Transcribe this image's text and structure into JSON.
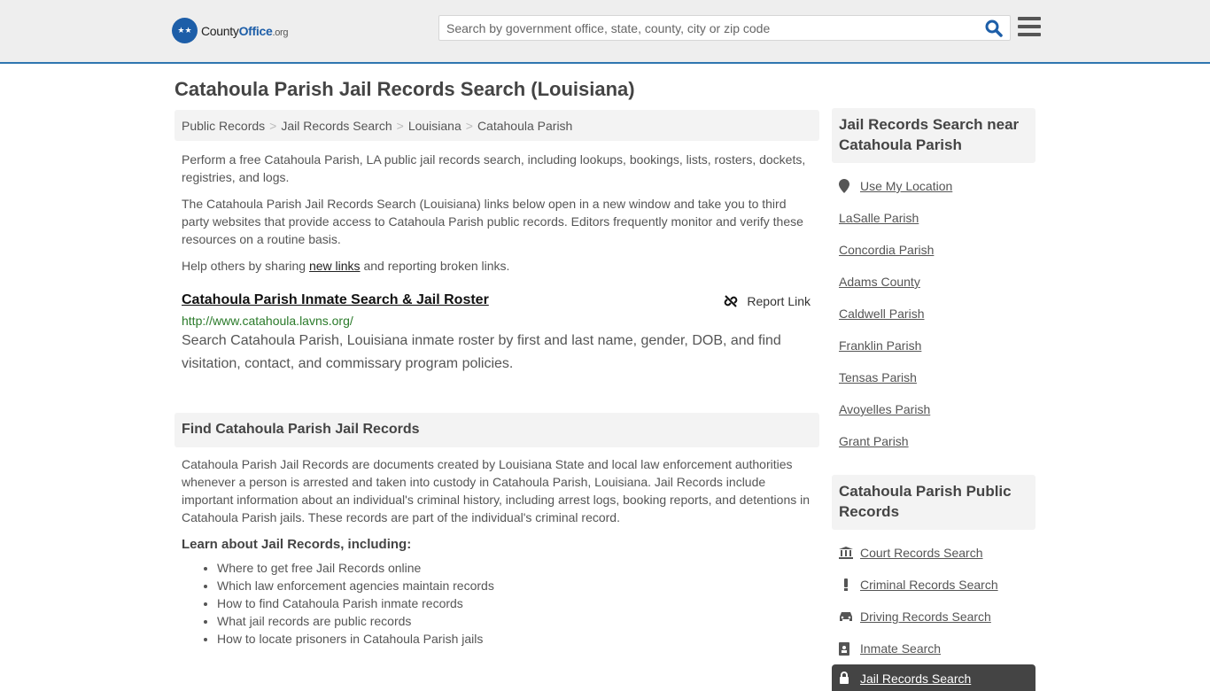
{
  "header": {
    "logo": {
      "part1": "County",
      "part2": "Office",
      "part3": ".org"
    },
    "search": {
      "placeholder": "Search by government office, state, county, city or zip code",
      "value": ""
    }
  },
  "page": {
    "title": "Catahoula Parish Jail Records Search (Louisiana)",
    "breadcrumbs": [
      "Public Records",
      "Jail Records Search",
      "Louisiana",
      "Catahoula Parish"
    ],
    "intro1": "Perform a free Catahoula Parish, LA public jail records search, including lookups, bookings, lists, rosters, dockets, registries, and logs.",
    "intro2": "The Catahoula Parish Jail Records Search (Louisiana) links below open in a new window and take you to third party websites that provide access to Catahoula Parish public records. Editors frequently monitor and verify these resources on a routine basis.",
    "help": {
      "before": "Help others by sharing ",
      "link": "new links",
      "after": " and reporting broken links."
    },
    "listing": {
      "title": "Catahoula Parish Inmate Search & Jail Roster",
      "report_label": "Report Link",
      "url": "http://www.catahoula.lavns.org/",
      "description": "Search Catahoula Parish, Louisiana inmate roster by first and last name, gender, DOB, and find visitation, contact, and commissary program policies."
    },
    "find_section": {
      "heading": "Find Catahoula Parish Jail Records",
      "body": "Catahoula Parish Jail Records are documents created by Louisiana State and local law enforcement authorities whenever a person is arrested and taken into custody in Catahoula Parish, Louisiana. Jail Records include important information about an individual's criminal history, including arrest logs, booking reports, and detentions in Catahoula Parish jails. These records are part of the individual's criminal record.",
      "learn_heading": "Learn about Jail Records, including:",
      "learn_items": [
        "Where to get free Jail Records online",
        "Which law enforcement agencies maintain records",
        "How to find Catahoula Parish inmate records",
        "What jail records are public records",
        "How to locate prisoners in Catahoula Parish jails"
      ]
    }
  },
  "sidebar": {
    "nearby": {
      "heading": "Jail Records Search near Catahoula Parish",
      "use_location": "Use My Location",
      "items": [
        "LaSalle Parish",
        "Concordia Parish",
        "Adams County",
        "Caldwell Parish",
        "Franklin Parish",
        "Tensas Parish",
        "Avoyelles Parish",
        "Grant Parish"
      ]
    },
    "public_records": {
      "heading": "Catahoula Parish Public Records",
      "items": [
        {
          "label": "Court Records Search",
          "icon": "courthouse-icon"
        },
        {
          "label": "Criminal Records Search",
          "icon": "exclamation-icon"
        },
        {
          "label": "Driving Records Search",
          "icon": "car-icon"
        },
        {
          "label": "Inmate Search",
          "icon": "id-badge-icon"
        },
        {
          "label": "Jail Records Search",
          "icon": "lock-icon",
          "active": true
        }
      ]
    }
  }
}
